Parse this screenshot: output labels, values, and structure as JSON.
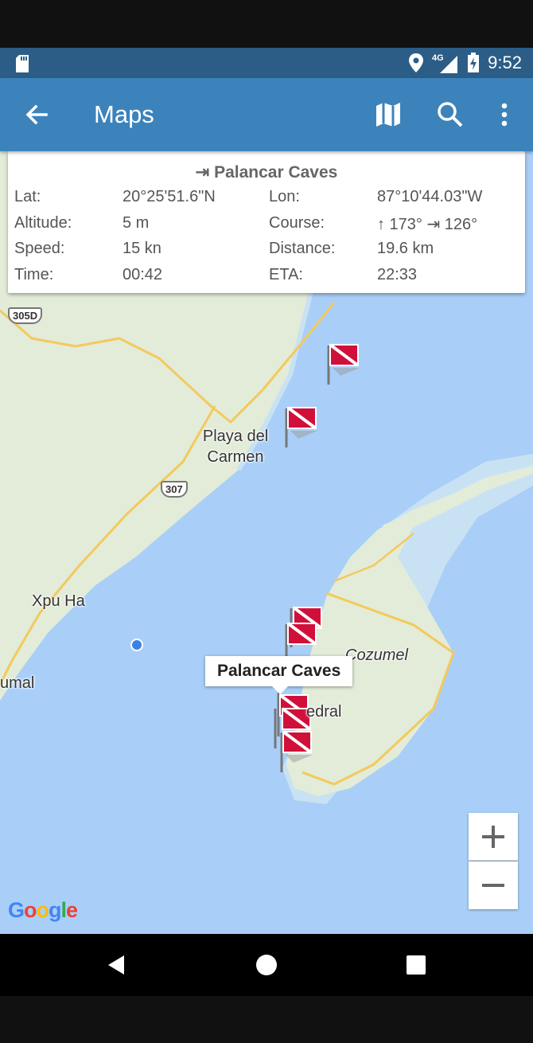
{
  "status": {
    "time": "9:52",
    "network": "4G"
  },
  "appbar": {
    "title": "Maps"
  },
  "info": {
    "destination": "⇥ Palancar Caves",
    "rows": [
      {
        "l1": "Lat:",
        "v1": "20°25'51.6\"N",
        "l2": "Lon:",
        "v2": "87°10'44.03\"W"
      },
      {
        "l1": "Altitude:",
        "v1": "5 m",
        "l2": "Course:",
        "v2": "↑ 173° ⇥ 126°"
      },
      {
        "l1": "Speed:",
        "v1": "15 kn",
        "l2": "Distance:",
        "v2": "19.6 km"
      },
      {
        "l1": "Time:",
        "v1": "00:42",
        "l2": "ETA:",
        "v2": "22:33"
      }
    ]
  },
  "map": {
    "labels": {
      "playa": "Playa del Carmen",
      "xpu": "Xpu Ha",
      "tulum": "umal",
      "cozumel": "Cozumel",
      "cedral": "edral"
    },
    "shields": {
      "r305": "305D",
      "r307": "307"
    },
    "tooltip": "Palancar Caves",
    "colors": {
      "water": "#a9cff8",
      "land": "#e2ecd8",
      "road": "#f4c95d",
      "flag": "#d0103a"
    }
  },
  "zoom": {
    "in": "+",
    "out": "−"
  },
  "google": [
    "G",
    "o",
    "o",
    "g",
    "l",
    "e"
  ]
}
